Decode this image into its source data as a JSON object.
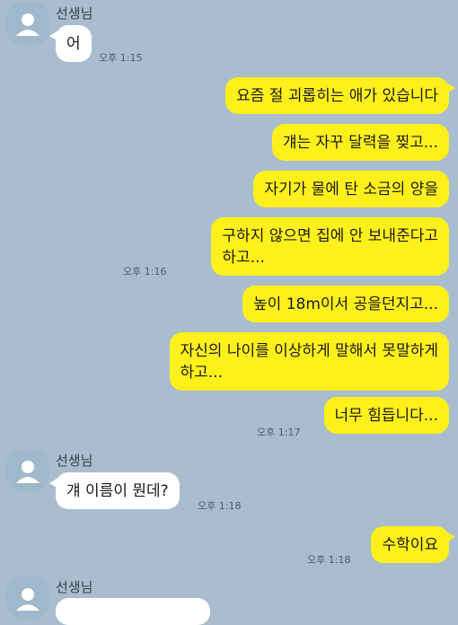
{
  "chat": {
    "messages": [
      {
        "sender": "선생님",
        "text": "어",
        "time": "오후 1:15"
      },
      {
        "text": "요즘 절 괴롭히는 애가 있습니다"
      },
      {
        "text": "걔는 자꾸 달력을 찢고..."
      },
      {
        "text": "자기가 물에 탄 소금의 양을"
      },
      {
        "text": "구하지 않으면 집에 안 보내준다고\n하고...",
        "time": "오후 1:16"
      },
      {
        "text": "높이 18m이서 공을던지고..."
      },
      {
        "text": "자신의 나이를 이상하게 말해서 못말하게\n하고..."
      },
      {
        "text": "너무 힘듭니다...",
        "time": "오후 1:17"
      },
      {
        "sender": "선생님",
        "text": "걔 이름이 뭔데?",
        "time": "오후 1:18"
      },
      {
        "text": "수학이요",
        "time": "오후 1:18"
      },
      {
        "sender": "선생님"
      }
    ]
  },
  "colors": {
    "background": "#a9bdce",
    "outgoing_bubble": "#fef01b",
    "incoming_bubble": "#ffffff",
    "avatar": "#9fb8cb"
  }
}
